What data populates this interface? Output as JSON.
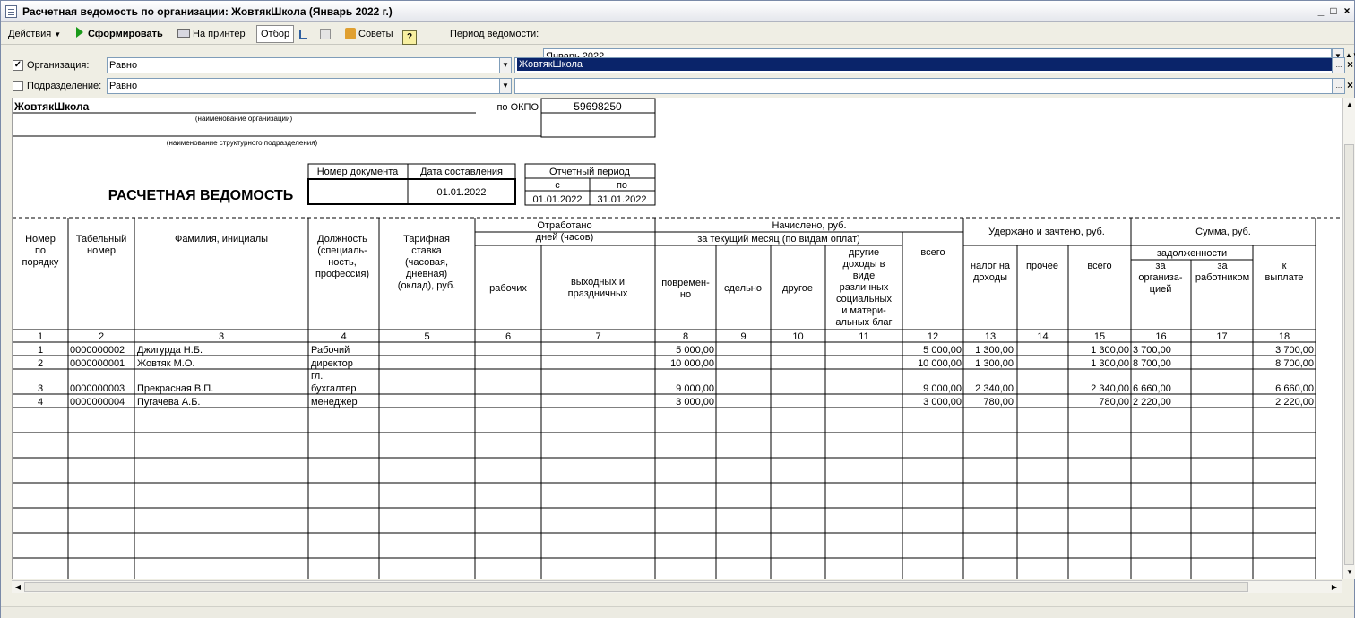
{
  "window": {
    "title": "Расчетная ведомость по организации: ЖовтякШкола (Январь 2022 г.)"
  },
  "toolbar": {
    "actions_label": "Действия",
    "form_label": "Сформировать",
    "print_label": "На принтер",
    "filter_label": "Отбор",
    "tips_label": "Советы",
    "help_label": "?",
    "period_label": "Период ведомости:",
    "period_value": "Январь 2022"
  },
  "filters": [
    {
      "label": "Организация:",
      "checked": true,
      "check_mark": "✓",
      "condition": "Равно",
      "value": "ЖовтякШкола"
    },
    {
      "label": "Подразделение:",
      "checked": false,
      "check_mark": "",
      "condition": "Равно",
      "value": ""
    }
  ],
  "report": {
    "org_name": "ЖовтякШкола",
    "org_caption": "(наименование организации)",
    "okpo_label": "по ОКПО",
    "okpo_value": "59698250",
    "dept_caption": "(наименование структурного подразделения)",
    "doc_title": "РАСЧЕТНАЯ ВЕДОМОСТЬ",
    "doc_number_label": "Номер документа",
    "doc_date_label": "Дата составления",
    "doc_number": "",
    "doc_date": "01.01.2022",
    "period_label": "Отчетный период",
    "period_from_label": "с",
    "period_to_label": "по",
    "period_from": "01.01.2022",
    "period_to": "31.01.2022",
    "headers": {
      "h1": [
        "Номер",
        "по",
        "порядку"
      ],
      "h2": [
        "Табельный",
        "номер"
      ],
      "h3": [
        "Фамилия, инициалы"
      ],
      "h4": [
        "Должность",
        "(специаль-",
        "ность,",
        "профессия)"
      ],
      "h5": [
        "Тарифная",
        "ставка",
        "(часовая,",
        "дневная)",
        "(оклад), руб."
      ],
      "worked": [
        "Отработано",
        "дней (часов)"
      ],
      "h6": [
        "рабочих"
      ],
      "h7": [
        "выходных и",
        "праздничных"
      ],
      "accrued": [
        "Начислено, руб."
      ],
      "current_month": [
        "за текущий месяц (по видам оплат)"
      ],
      "h8": [
        "повремен-",
        "но"
      ],
      "h9": [
        "сдельно"
      ],
      "h10": [
        "другое"
      ],
      "h11": [
        "другие",
        "доходы в",
        "виде",
        "различных",
        "социальных",
        "и матери-",
        "альных благ"
      ],
      "h12": [
        "всего"
      ],
      "withheld": [
        "Удержано и зачтено, руб."
      ],
      "h13": [
        "налог на",
        "доходы"
      ],
      "h14": [
        "прочее"
      ],
      "h15": [
        "всего"
      ],
      "sum": [
        "Сумма, руб."
      ],
      "debt": [
        "задолженности"
      ],
      "h16": [
        "за",
        "организа-",
        "цией"
      ],
      "h17": [
        "за",
        "работником"
      ],
      "h18": [
        "к",
        "выплате"
      ]
    },
    "col_numbers": [
      "1",
      "2",
      "3",
      "4",
      "5",
      "6",
      "7",
      "8",
      "9",
      "10",
      "11",
      "12",
      "13",
      "14",
      "15",
      "16",
      "17",
      "18"
    ],
    "rows": [
      {
        "n": "1",
        "tab": "0000000002",
        "name": "Джигурда Н.Б.",
        "pos": [
          "Рабочий"
        ],
        "c8": "5 000,00",
        "c12": "5 000,00",
        "c13": "1 300,00",
        "c15": "1 300,00",
        "c16": "3 700,00",
        "c18": "3 700,00"
      },
      {
        "n": "2",
        "tab": "0000000001",
        "name": "Жовтяк М.О.",
        "pos": [
          "директор"
        ],
        "c8": "10 000,00",
        "c12": "10 000,00",
        "c13": "1 300,00",
        "c15": "1 300,00",
        "c16": "8 700,00",
        "c18": "8 700,00"
      },
      {
        "n": "3",
        "tab": "0000000003",
        "name": "Прекрасная В.П.",
        "pos": [
          "гл.",
          "бухгалтер"
        ],
        "c8": "9 000,00",
        "c12": "9 000,00",
        "c13": "2 340,00",
        "c15": "2 340,00",
        "c16": "6 660,00",
        "c18": "6 660,00"
      },
      {
        "n": "4",
        "tab": "0000000004",
        "name": "Пугачева А.Б.",
        "pos": [
          "менеджер"
        ],
        "c8": "3 000,00",
        "c12": "3 000,00",
        "c13": "780,00",
        "c15": "780,00",
        "c16": "2 220,00",
        "c18": "2 220,00"
      }
    ]
  },
  "colors": {
    "selection": "#0a246a",
    "grid": "#000000"
  }
}
